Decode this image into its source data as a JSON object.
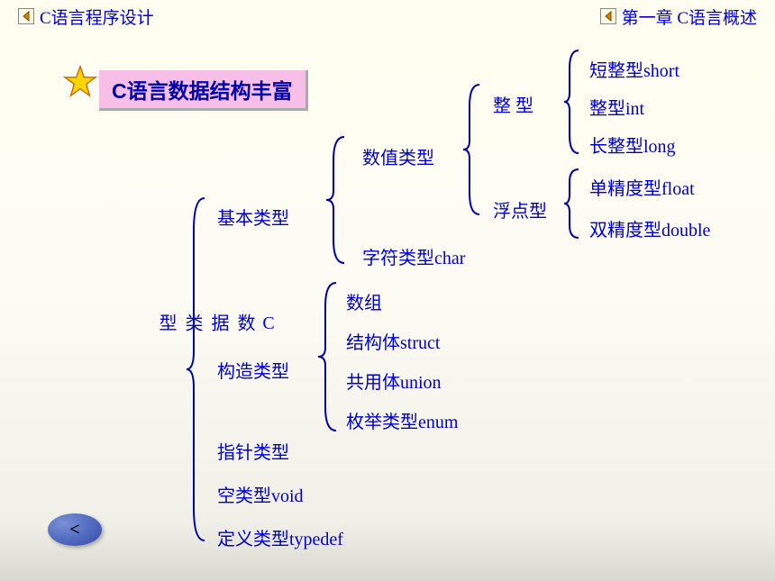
{
  "header": {
    "left": "C语言程序设计",
    "right": "第一章  C语言概述"
  },
  "heading": "C语言数据结构丰富",
  "tree": {
    "root": "C\n数\n据\n类\n型",
    "basic": "基本类型",
    "construct": "构造类型",
    "pointer": "指针类型",
    "void": "空类型void",
    "typedef": "定义类型typedef",
    "numeric": "数值类型",
    "char": "字符类型char",
    "integer": "整  型",
    "float": "浮点型",
    "short": "短整型short",
    "int": "整型int",
    "long": "长整型long",
    "single": "单精度型float",
    "double": "双精度型double",
    "array": "数组",
    "struct": "结构体struct",
    "union": "共用体union",
    "enum": "枚举类型enum"
  },
  "back": "<"
}
